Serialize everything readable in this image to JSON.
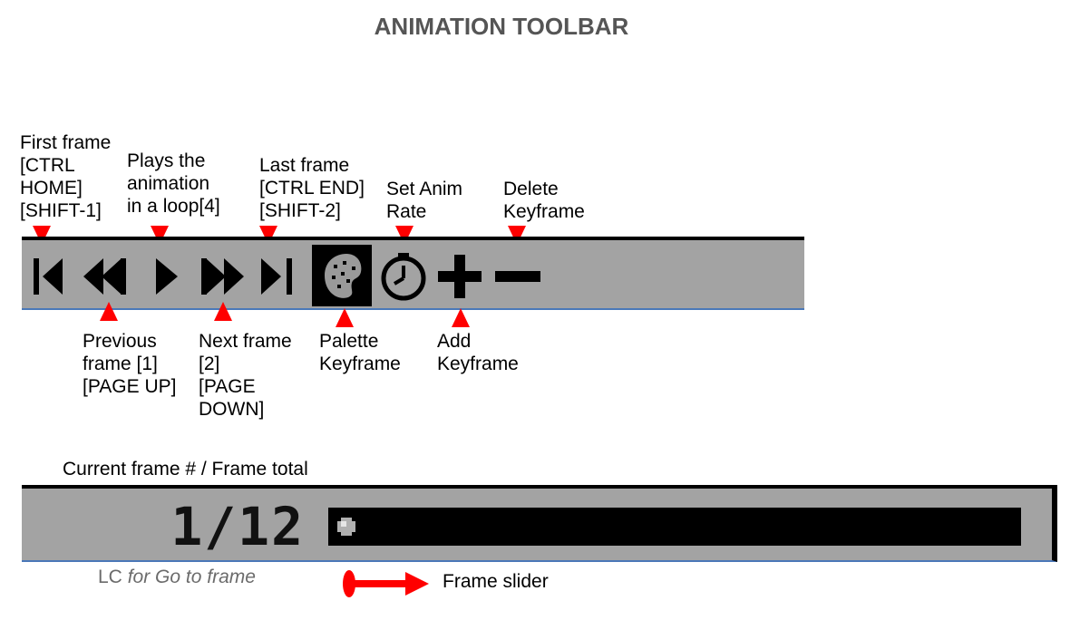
{
  "title": "ANIMATION TOOLBAR",
  "labels": {
    "first_frame": "First frame\n[CTRL\nHOME]\n[SHIFT-1]",
    "play": "Plays the\nanimation\nin a loop[4]",
    "last_frame": "Last frame\n[CTRL END]\n[SHIFT-2]",
    "set_anim_rate": "Set Anim\nRate",
    "delete_keyframe": "Delete\nKeyframe",
    "previous_frame": "Previous\nframe [1]\n[PAGE UP]",
    "next_frame": "Next frame\n[2]\n[PAGE\nDOWN]",
    "palette_keyframe": "Palette\nKeyframe",
    "add_keyframe": "Add\nKeyframe"
  },
  "toolbar_icons": [
    "first-frame-icon",
    "previous-frame-icon",
    "play-icon",
    "next-frame-icon",
    "last-frame-icon",
    "palette-keyframe-icon",
    "clock-icon",
    "plus-icon",
    "minus-icon"
  ],
  "frame_bar": {
    "caption": "Current frame # / Frame total",
    "counter": "1/12",
    "current_frame": 1,
    "total_frames": 12,
    "hint_prefix": "LC",
    "hint_suffix": "for Go to frame",
    "slider_label": "Frame slider"
  },
  "colors": {
    "accent": "#ff0000",
    "toolbar_bg": "#a3a3a3",
    "title": "#555555"
  }
}
